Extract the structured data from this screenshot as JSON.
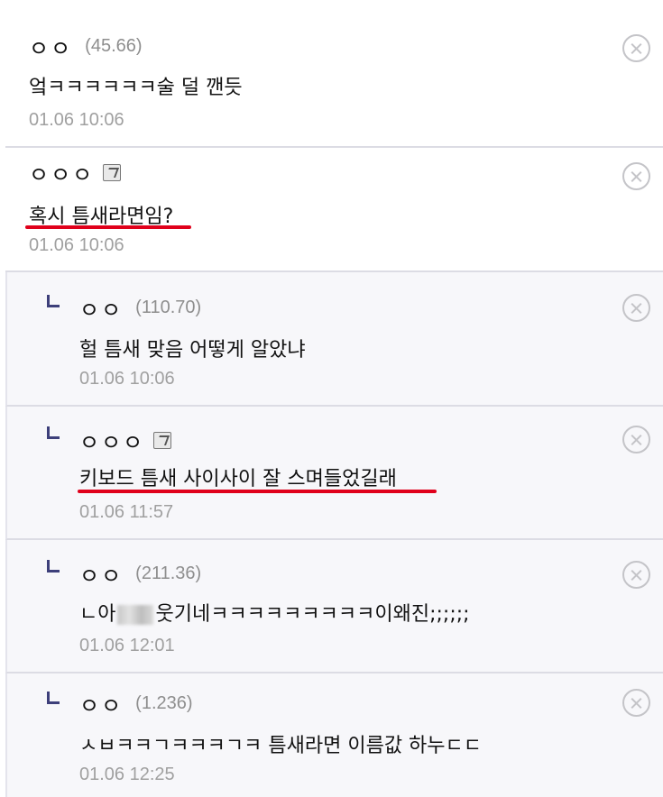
{
  "comments": [
    {
      "nick": "ㅇㅇ",
      "ip": "(45.66)",
      "text": "엌ㅋㅋㅋㅋㅋㅋ술 덜 깬듯",
      "date": "01.06 10:06"
    },
    {
      "nick": "ㅇㅇㅇ",
      "text": "혹시 틈새라면임?",
      "date": "01.06 10:06"
    },
    {
      "nick": "ㅇㅇ",
      "ip": "(110.70)",
      "text": "헐 틈새 맞음 어떻게 알았냐",
      "date": "01.06 10:06"
    },
    {
      "nick": "ㅇㅇㅇ",
      "text": "키보드 틈새 사이사이 잘 스며들었길래",
      "date": "01.06 11:57"
    },
    {
      "nick": "ㅇㅇ",
      "ip": "(211.36)",
      "text_before": "ㄴ아",
      "text_after": "웃기네ㅋㅋㅋㅋㅋㅋㅋㅋㅋ이왜진;;;;;;",
      "date": "01.06 12:01"
    },
    {
      "nick": "ㅇㅇ",
      "ip": "(1.236)",
      "text": "ㅅㅂㅋㅋㄱㅋㅋㅋㄱㅋ 틈새라면 이름값 하누ㄷㄷ",
      "date": "01.06 12:25"
    }
  ],
  "colors": {
    "underline": "#e0001b",
    "reply_icon": "#3d3f7a",
    "date": "#a0a0a0",
    "ip": "#8e8e8e"
  },
  "icons": {
    "delete": "close-circle-icon",
    "reply": "reply-arrow-icon",
    "fixed_nick": "fixed-nick-badge-icon"
  }
}
